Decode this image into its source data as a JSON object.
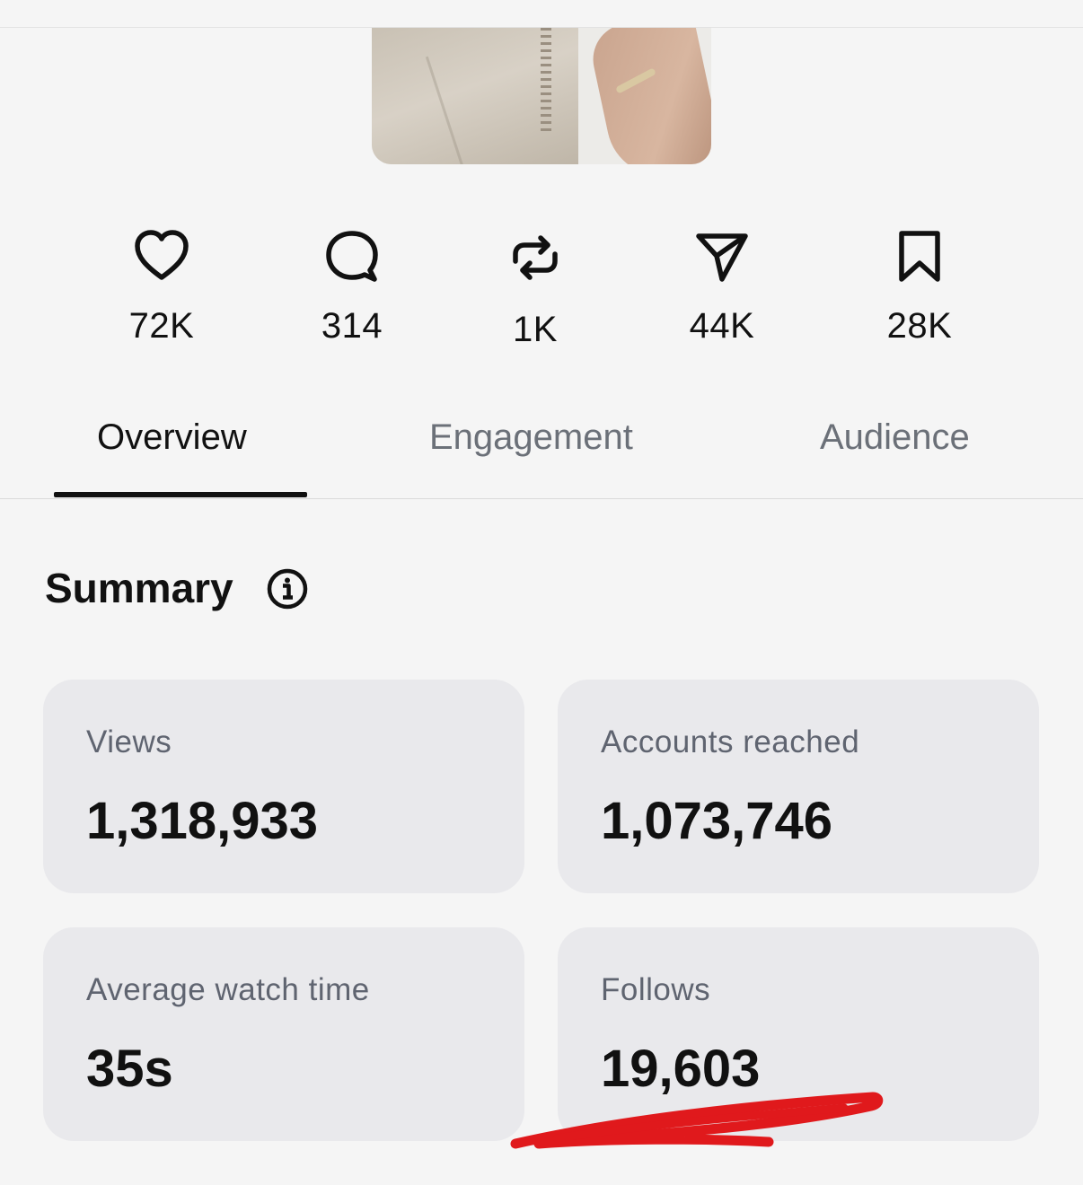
{
  "post": {
    "thumbnail_icon": "post-thumbnail"
  },
  "metrics": [
    {
      "icon": "heart-icon",
      "value": "72K"
    },
    {
      "icon": "comment-icon",
      "value": "314"
    },
    {
      "icon": "repost-icon",
      "value": "1K"
    },
    {
      "icon": "send-icon",
      "value": "44K"
    },
    {
      "icon": "bookmark-icon",
      "value": "28K"
    }
  ],
  "tabs": [
    {
      "label": "Overview",
      "active": true
    },
    {
      "label": "Engagement",
      "active": false
    },
    {
      "label": "Audience",
      "active": false
    }
  ],
  "summary": {
    "title": "Summary",
    "info_icon": "info-icon",
    "cards": [
      {
        "label": "Views",
        "value": "1,318,933"
      },
      {
        "label": "Accounts reached",
        "value": "1,073,746"
      },
      {
        "label": "Average watch time",
        "value": "35s"
      },
      {
        "label": "Follows",
        "value": "19,603"
      }
    ]
  },
  "colors": {
    "background": "#f5f5f5",
    "card": "#e9e9ec",
    "text_primary": "#111111",
    "text_secondary": "#5f6470",
    "tab_inactive": "#6b7078",
    "annotation": "#e0191c"
  }
}
